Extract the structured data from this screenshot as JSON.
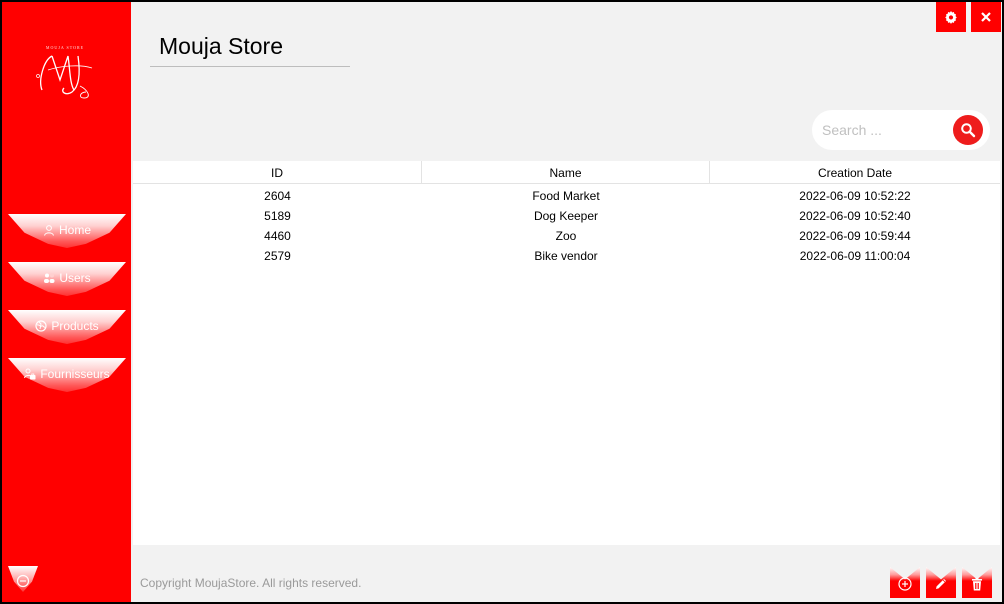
{
  "app": {
    "title": "Mouja Store",
    "logo_monogram": "MJ",
    "logo_caption": "MOUJA STORE"
  },
  "sidebar": {
    "items": [
      {
        "label": "Home",
        "icon": "user-icon"
      },
      {
        "label": "Users",
        "icon": "users-icon"
      },
      {
        "label": "Products",
        "icon": "globe-icon"
      },
      {
        "label": "Fournisseurs",
        "icon": "supplier-icon"
      }
    ],
    "logout_icon": "logout-icon"
  },
  "window_controls": {
    "settings_icon": "gear-icon",
    "close_icon": "close-icon"
  },
  "search": {
    "placeholder": "Search ...",
    "value": "",
    "icon": "search-icon"
  },
  "table": {
    "columns": [
      "ID",
      "Name",
      "Creation Date"
    ],
    "rows": [
      [
        "2604",
        "Food Market",
        "2022-06-09 10:52:22"
      ],
      [
        "5189",
        "Dog Keeper",
        "2022-06-09 10:52:40"
      ],
      [
        "4460",
        "Zoo",
        "2022-06-09 10:59:44"
      ],
      [
        "2579",
        "Bike vendor",
        "2022-06-09 11:00:04"
      ]
    ]
  },
  "footer": {
    "copyright": "Copyright MoujaStore. All rights reserved.",
    "actions": [
      {
        "name": "add",
        "icon": "plus-circle-icon"
      },
      {
        "name": "edit",
        "icon": "pencil-icon"
      },
      {
        "name": "delete",
        "icon": "trash-icon"
      }
    ]
  },
  "colors": {
    "accent": "#ff0000",
    "background": "#f2f2f2",
    "table_background": "#ffffff",
    "muted_text": "#9a9a9a"
  }
}
